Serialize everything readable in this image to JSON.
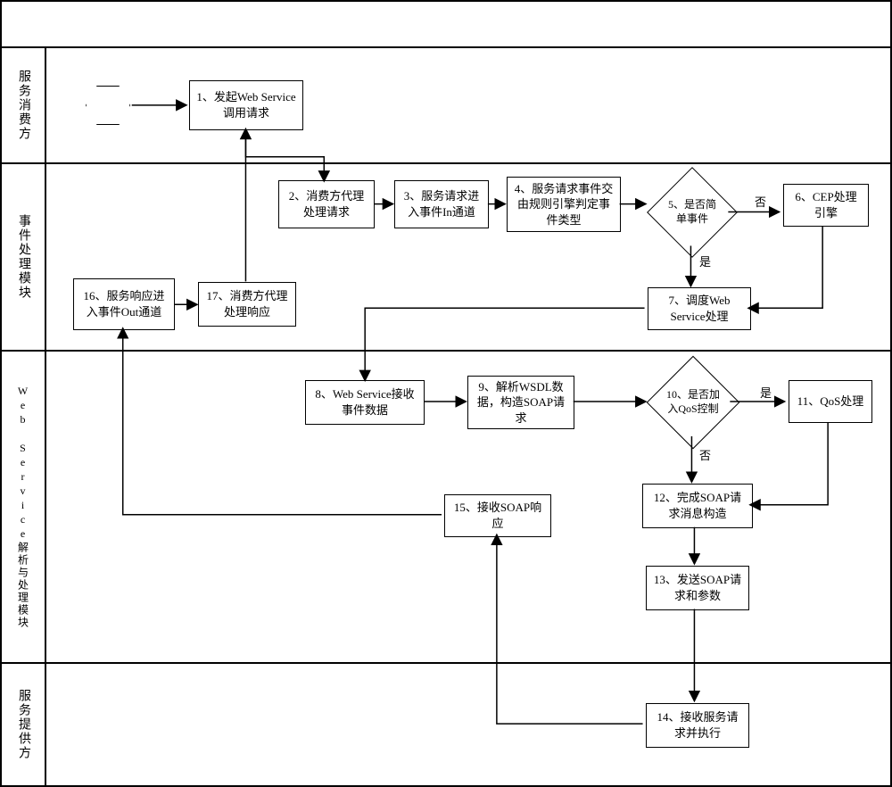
{
  "diagram": {
    "type": "swimlane-flowchart",
    "lanes": [
      {
        "id": "consumer",
        "label": "服务消费方"
      },
      {
        "id": "event",
        "label": "事件处理模块"
      },
      {
        "id": "ws",
        "label": "Web Service解析与处理模块"
      },
      {
        "id": "provider",
        "label": "服务提供方"
      }
    ],
    "nodes": {
      "n1": "1、发起Web Service调用请求",
      "n2": "2、消费方代理处理请求",
      "n3": "3、服务请求进入事件In通道",
      "n4": "4、服务请求事件交由规则引擎判定事件类型",
      "n5": "5、是否简单事件",
      "n6": "6、CEP处理引擎",
      "n7": "7、调度Web Service处理",
      "n8": "8、Web Service接收事件数据",
      "n9": "9、解析WSDL数据，构造SOAP请求",
      "n10": "10、是否加入QoS控制",
      "n11": "11、QoS处理",
      "n12": "12、完成SOAP请求消息构造",
      "n13": "13、发送SOAP请求和参数",
      "n14": "14、接收服务请求并执行",
      "n15": "15、接收SOAP响应",
      "n16": "16、服务响应进入事件Out通道",
      "n17": "17、消费方代理处理响应"
    },
    "edgeLabels": {
      "yes5": "是",
      "no5": "否",
      "yes10": "是",
      "no10": "否"
    },
    "flow": [
      [
        "start",
        "n1"
      ],
      [
        "n1",
        "n2"
      ],
      [
        "n2",
        "n3"
      ],
      [
        "n3",
        "n4"
      ],
      [
        "n4",
        "n5"
      ],
      [
        "n5",
        "n6",
        "否"
      ],
      [
        "n5",
        "n7",
        "是"
      ],
      [
        "n6",
        "n7"
      ],
      [
        "n7",
        "n8"
      ],
      [
        "n8",
        "n9"
      ],
      [
        "n9",
        "n10"
      ],
      [
        "n10",
        "n11",
        "是"
      ],
      [
        "n10",
        "n12",
        "否"
      ],
      [
        "n11",
        "n12"
      ],
      [
        "n12",
        "n13"
      ],
      [
        "n13",
        "n14"
      ],
      [
        "n14",
        "n15"
      ],
      [
        "n15",
        "n16"
      ],
      [
        "n16",
        "n17"
      ],
      [
        "n17",
        "n1"
      ]
    ]
  }
}
